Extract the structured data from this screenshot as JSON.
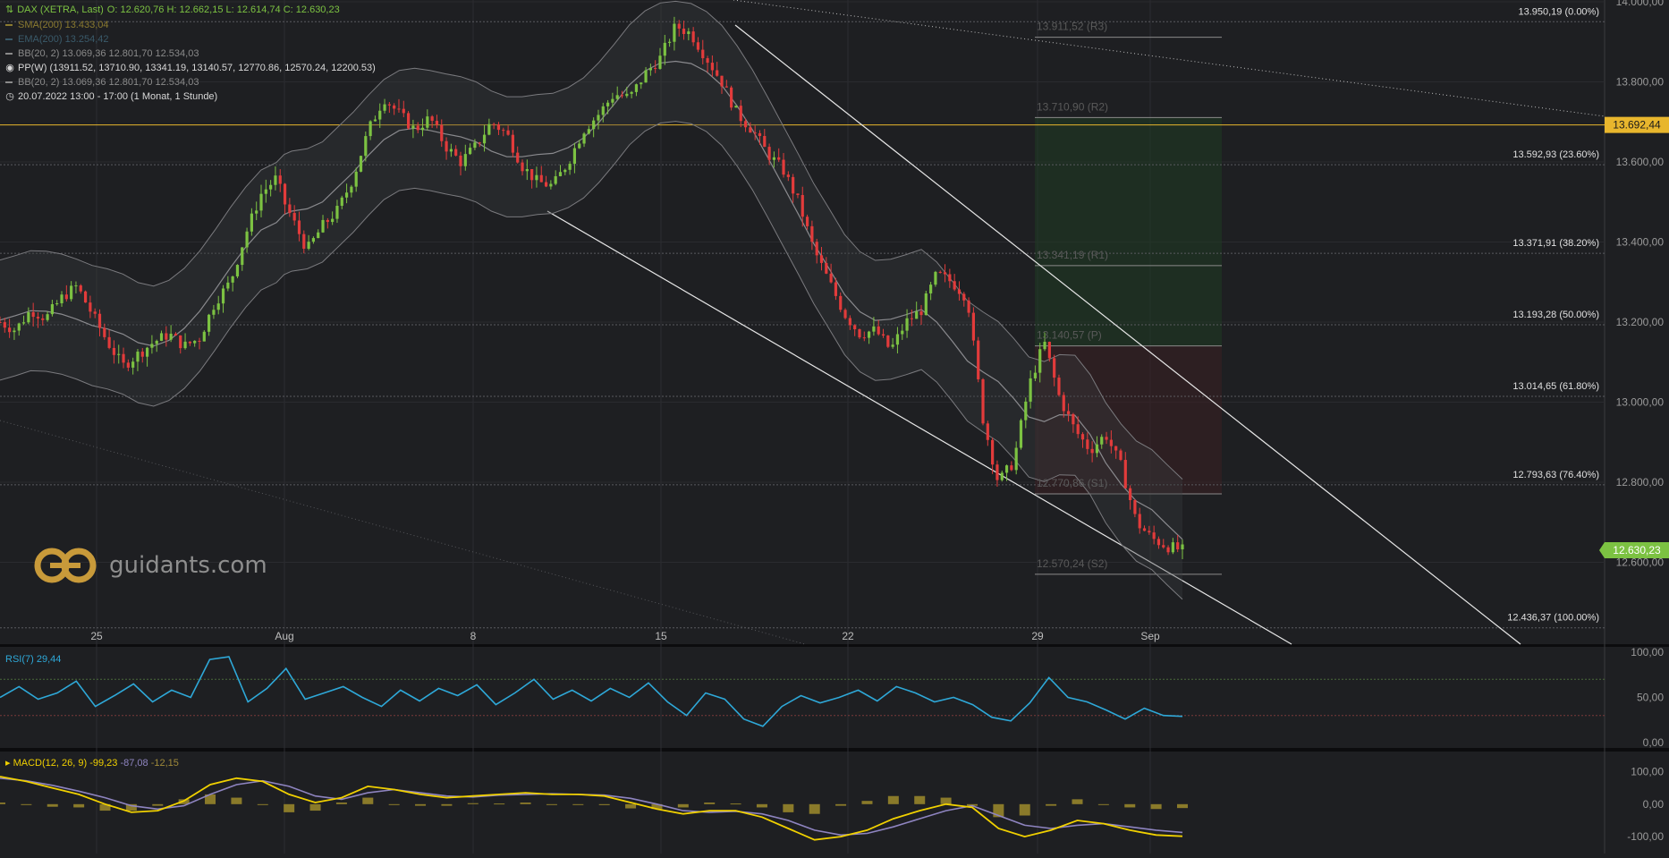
{
  "header": {
    "instrument": "DAX (XETRA, Last)",
    "ohlc": "O: 12.620,76  H: 12.662,15  L: 12.614,74  C: 12.630,23",
    "sma": "SMA(200)  13.433,04",
    "ema": "EMA(200)  13.254,42",
    "bb1": "BB(20, 2)  13.069,36  12.801,70  12.534,03",
    "pp": "PP(W)  (13911.52, 13710.90, 13341.19, 13140.57, 12770.86, 12570.24, 12200.53)",
    "bb2": "BB(20, 2)  13.069,36  12.801,70  12.534,03",
    "range": "20.07.2022 13:00 - 17:00   (1 Monat, 1 Stunde)"
  },
  "colors": {
    "background": "#1e1f22",
    "up": "#7cc242",
    "down": "#e23b3b",
    "horizontal_line": "#e8b62d",
    "last_price": "#7cc242",
    "rsi": "#2ea8d8",
    "macd": "#f0d000",
    "signal": "#8e84c0",
    "histogram": "#8a7a2a"
  },
  "watermark": "guidants.com",
  "icons": {
    "watermark": "guidants-logo-icon",
    "clock": "clock-icon",
    "pp": "circle-dot-icon"
  },
  "chart_data": [
    {
      "type": "candlestick",
      "title": "DAX (XETRA, Last)",
      "x_ticks": [
        "25",
        "Aug",
        "8",
        "15",
        "22",
        "29",
        "Sep"
      ],
      "y_ticks": [
        "14.000,00",
        "13.800,00",
        "13.600,00",
        "13.400,00",
        "13.200,00",
        "13.000,00",
        "12.800,00",
        "12.600,00"
      ],
      "ylim": [
        12400,
        14000
      ],
      "grid": true,
      "horizontal_line": {
        "value": 13692.44,
        "label": "13.692,44"
      },
      "last_price": {
        "value": 12630.23,
        "label": "12.630,23"
      },
      "fib_levels": [
        {
          "value": 13950.19,
          "label": "13.950,19 (0.00%)"
        },
        {
          "value": 13592.93,
          "label": "13.592,93 (23.60%)"
        },
        {
          "value": 13371.91,
          "label": "13.371,91 (38.20%)"
        },
        {
          "value": 13193.28,
          "label": "13.193,28 (50.00%)"
        },
        {
          "value": 13014.65,
          "label": "13.014,65 (61.80%)"
        },
        {
          "value": 12793.63,
          "label": "12.793,63 (76.40%)"
        },
        {
          "value": 12436.37,
          "label": "12.436,37 (100.00%)"
        }
      ],
      "pivot_levels": [
        {
          "value": 13911.52,
          "label": "13.911,52 (R3)"
        },
        {
          "value": 13710.9,
          "label": "13.710,90 (R2)"
        },
        {
          "value": 13341.19,
          "label": "13.341,19 (R1)"
        },
        {
          "value": 13140.57,
          "label": "13.140,57 (P)"
        },
        {
          "value": 12770.86,
          "label": "12.770,86 (S1)"
        },
        {
          "value": 12570.24,
          "label": "12.570,24 (S2)"
        }
      ],
      "price_path": [
        [
          0,
          13200
        ],
        [
          0.01,
          13180
        ],
        [
          0.02,
          13230
        ],
        [
          0.03,
          13210
        ],
        [
          0.04,
          13260
        ],
        [
          0.05,
          13290
        ],
        [
          0.06,
          13220
        ],
        [
          0.07,
          13150
        ],
        [
          0.08,
          13090
        ],
        [
          0.09,
          13120
        ],
        [
          0.1,
          13150
        ],
        [
          0.11,
          13170
        ],
        [
          0.12,
          13140
        ],
        [
          0.13,
          13160
        ],
        [
          0.14,
          13250
        ],
        [
          0.15,
          13300
        ],
        [
          0.16,
          13420
        ],
        [
          0.17,
          13520
        ],
        [
          0.18,
          13560
        ],
        [
          0.185,
          13500
        ],
        [
          0.19,
          13460
        ],
        [
          0.2,
          13380
        ],
        [
          0.21,
          13440
        ],
        [
          0.22,
          13480
        ],
        [
          0.23,
          13560
        ],
        [
          0.24,
          13680
        ],
        [
          0.25,
          13760
        ],
        [
          0.26,
          13720
        ],
        [
          0.27,
          13680
        ],
        [
          0.28,
          13710
        ],
        [
          0.29,
          13640
        ],
        [
          0.3,
          13600
        ],
        [
          0.31,
          13640
        ],
        [
          0.32,
          13700
        ],
        [
          0.33,
          13670
        ],
        [
          0.34,
          13590
        ],
        [
          0.35,
          13550
        ],
        [
          0.36,
          13540
        ],
        [
          0.37,
          13600
        ],
        [
          0.38,
          13680
        ],
        [
          0.39,
          13720
        ],
        [
          0.4,
          13770
        ],
        [
          0.41,
          13760
        ],
        [
          0.42,
          13820
        ],
        [
          0.43,
          13860
        ],
        [
          0.44,
          13940
        ],
        [
          0.45,
          13920
        ],
        [
          0.46,
          13860
        ],
        [
          0.47,
          13800
        ],
        [
          0.48,
          13720
        ],
        [
          0.49,
          13680
        ],
        [
          0.5,
          13620
        ],
        [
          0.51,
          13580
        ],
        [
          0.52,
          13500
        ],
        [
          0.53,
          13380
        ],
        [
          0.54,
          13300
        ],
        [
          0.55,
          13220
        ],
        [
          0.56,
          13170
        ],
        [
          0.57,
          13180
        ],
        [
          0.58,
          13130
        ],
        [
          0.59,
          13200
        ],
        [
          0.6,
          13230
        ],
        [
          0.61,
          13320
        ],
        [
          0.62,
          13300
        ],
        [
          0.63,
          13260
        ],
        [
          0.64,
          12960
        ],
        [
          0.65,
          12800
        ],
        [
          0.66,
          12850
        ],
        [
          0.67,
          13040
        ],
        [
          0.68,
          13150
        ],
        [
          0.69,
          13010
        ],
        [
          0.7,
          12930
        ],
        [
          0.71,
          12880
        ],
        [
          0.72,
          12920
        ],
        [
          0.73,
          12840
        ],
        [
          0.74,
          12700
        ],
        [
          0.75,
          12660
        ],
        [
          0.76,
          12640
        ],
        [
          0.77,
          12630
        ]
      ]
    },
    {
      "type": "line",
      "title": "RSI(7)",
      "legend_value": "29,44",
      "y_ticks": [
        "100,00",
        "50,00",
        "0,00"
      ],
      "ylim": [
        0,
        100
      ],
      "overbought": 70,
      "oversold": 30,
      "values": [
        50,
        62,
        48,
        55,
        68,
        40,
        52,
        65,
        45,
        58,
        50,
        92,
        95,
        45,
        60,
        82,
        48,
        55,
        62,
        50,
        40,
        58,
        46,
        60,
        52,
        64,
        42,
        55,
        70,
        48,
        58,
        46,
        60,
        50,
        66,
        45,
        30,
        55,
        48,
        26,
        18,
        40,
        52,
        44,
        50,
        58,
        46,
        62,
        55,
        45,
        50,
        42,
        28,
        24,
        44,
        72,
        50,
        45,
        36,
        26,
        38,
        30,
        29
      ]
    },
    {
      "type": "line",
      "title": "MACD(12, 26, 9)",
      "legend_values": [
        "-99,23",
        "-87,08",
        "-12,15"
      ],
      "y_ticks": [
        "100,00",
        "0,00",
        "-100,00"
      ],
      "ylim": [
        -130,
        140
      ],
      "series": [
        {
          "name": "MACD",
          "values": [
            85,
            70,
            50,
            30,
            0,
            -25,
            -20,
            10,
            60,
            80,
            70,
            30,
            5,
            20,
            55,
            45,
            30,
            20,
            25,
            30,
            35,
            30,
            30,
            25,
            5,
            -15,
            -30,
            -20,
            -20,
            -40,
            -75,
            -110,
            -100,
            -80,
            -45,
            -20,
            0,
            -10,
            -75,
            -100,
            -80,
            -50,
            -60,
            -80,
            -95,
            -99
          ]
        },
        {
          "name": "Signal",
          "values": [
            80,
            72,
            58,
            40,
            20,
            -5,
            -15,
            -5,
            30,
            60,
            72,
            55,
            25,
            15,
            35,
            45,
            35,
            25,
            22,
            28,
            30,
            32,
            30,
            28,
            18,
            0,
            -20,
            -25,
            -22,
            -30,
            -50,
            -80,
            -95,
            -90,
            -70,
            -45,
            -20,
            -5,
            -35,
            -65,
            -75,
            -65,
            -60,
            -70,
            -80,
            -87
          ]
        },
        {
          "name": "Histogram",
          "values": [
            5,
            -2,
            -8,
            -10,
            -20,
            -20,
            -5,
            15,
            30,
            20,
            -2,
            -25,
            -20,
            5,
            20,
            0,
            -5,
            -5,
            3,
            2,
            5,
            -2,
            0,
            -3,
            -13,
            -15,
            -10,
            5,
            2,
            -10,
            -25,
            -30,
            -5,
            10,
            25,
            25,
            20,
            -5,
            -40,
            -35,
            -5,
            15,
            0,
            -10,
            -15,
            -12
          ]
        }
      ]
    }
  ]
}
